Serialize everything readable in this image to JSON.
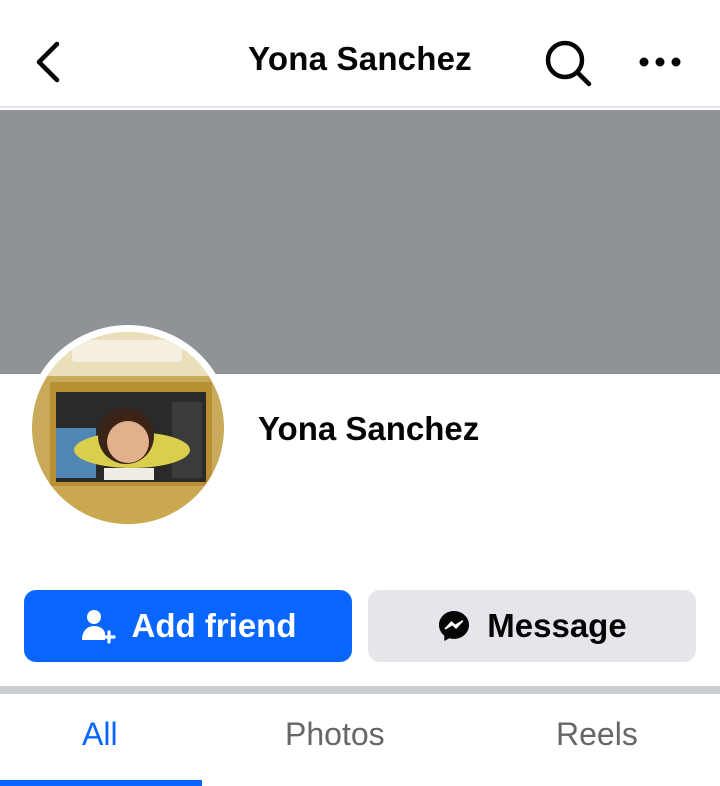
{
  "header": {
    "title": "Yona Sanchez",
    "back_icon": "chevron-left-icon",
    "search_icon": "search-icon",
    "more_icon": "more-horizontal-icon"
  },
  "profile": {
    "name": "Yona Sanchez"
  },
  "actions": {
    "add_friend_label": "Add friend",
    "add_friend_icon": "add-friend-icon",
    "message_label": "Message",
    "message_icon": "messenger-icon"
  },
  "tabs": [
    {
      "label": "All",
      "active": true
    },
    {
      "label": "Photos",
      "active": false
    },
    {
      "label": "Reels",
      "active": false
    }
  ],
  "colors": {
    "accent": "#0866ff",
    "cover": "#8f9296",
    "secondary_button": "#e4e6eb",
    "tab_inactive": "#65676b"
  }
}
